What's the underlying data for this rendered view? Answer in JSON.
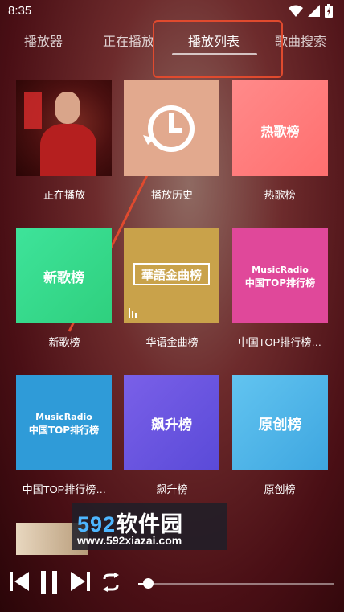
{
  "status_bar": {
    "time": "8:35"
  },
  "tabs": [
    {
      "label": "播放器"
    },
    {
      "label": "正在播放"
    },
    {
      "label": "播放列表"
    },
    {
      "label": "歌曲搜索"
    }
  ],
  "active_tab": 2,
  "grid": [
    {
      "caption": "正在播放",
      "tile_text": "",
      "bg": "#3a0c0c"
    },
    {
      "caption": "播放历史",
      "tile_text": "",
      "bg": "#e2a98e"
    },
    {
      "caption": "热歌榜",
      "tile_text": "热歌榜",
      "bg": "#ff7f7f"
    },
    {
      "caption": "新歌榜",
      "tile_text": "新歌榜",
      "bg": "#3dd98b"
    },
    {
      "caption": "华语金曲榜",
      "tile_text": "華語金曲榜",
      "bg": "#c9a24a"
    },
    {
      "caption": "中国TOP排行榜…",
      "tile_text_top": "MusicRadio",
      "tile_text": "中国TOP排行榜",
      "bg": "#e0489a"
    },
    {
      "caption": "中国TOP排行榜…",
      "tile_text_top": "MusicRadio",
      "tile_text": "中国TOP排行榜",
      "bg": "#2f9bd8"
    },
    {
      "caption": "飙升榜",
      "tile_text": "飙升榜",
      "bg": "#6b58e0"
    },
    {
      "caption": "原创榜",
      "tile_text": "原创榜",
      "bg": "#4fb4e6"
    }
  ],
  "watermark": {
    "number": "592",
    "title_suffix": "软件园",
    "url": "www.592xiazai.com"
  },
  "player": {
    "progress": 0.05
  },
  "colors": {
    "accent_annotation": "#e04a2e"
  }
}
